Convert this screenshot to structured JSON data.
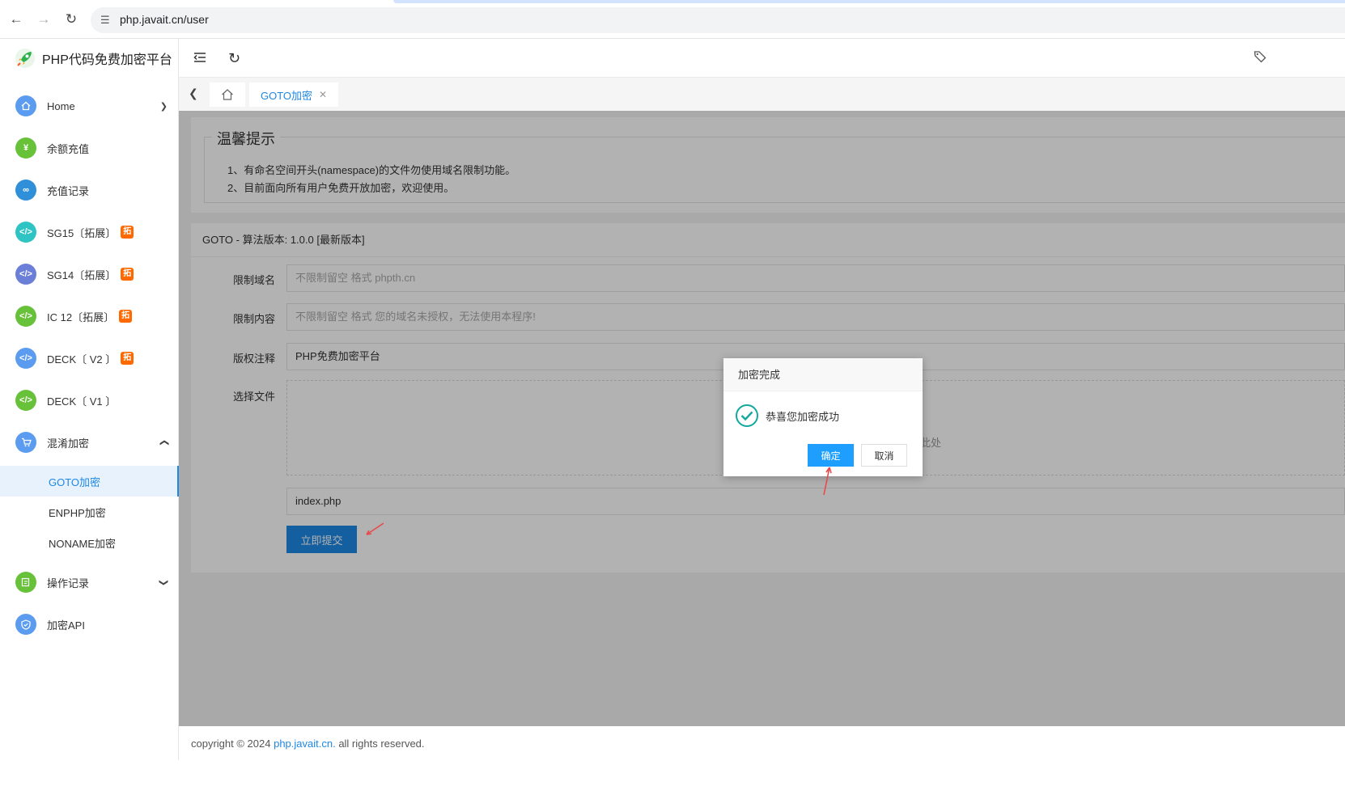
{
  "browser": {
    "url": "php.javait.cn/user"
  },
  "sidebar": {
    "logo_text": "PHP代码免费加密平台",
    "items": [
      {
        "label": "Home",
        "badge": "",
        "icon": "home-icon",
        "color": "#5b9cf0"
      },
      {
        "label": "余额充值",
        "badge": "",
        "icon": "recharge-icon",
        "color": "#67c23a"
      },
      {
        "label": "充值记录",
        "badge": "",
        "icon": "infinity-icon",
        "color": "#2f8fd8"
      },
      {
        "label": "SG15〔拓展〕",
        "badge": "拓",
        "icon": "code-icon",
        "color": "#2ec4c4"
      },
      {
        "label": "SG14〔拓展〕",
        "badge": "拓",
        "icon": "code-icon",
        "color": "#6c7fd8"
      },
      {
        "label": "IC 12〔拓展〕",
        "badge": "拓",
        "icon": "code-icon",
        "color": "#67c23a"
      },
      {
        "label": "DECK〔 V2 〕",
        "badge": "拓",
        "icon": "code-icon",
        "color": "#5b9cf0"
      },
      {
        "label": "DECK〔 V1 〕",
        "badge": "",
        "icon": "code-icon",
        "color": "#67c23a"
      },
      {
        "label": "混淆加密",
        "badge": "",
        "icon": "cart-icon",
        "color": "#5b9cf0"
      },
      {
        "label": "操作记录",
        "badge": "",
        "icon": "edit-icon",
        "color": "#67c23a"
      },
      {
        "label": "加密API",
        "badge": "",
        "icon": "shield-icon",
        "color": "#5b9cf0"
      }
    ],
    "submenu": [
      "GOTO加密",
      "ENPHP加密",
      "NONAME加密"
    ]
  },
  "tabs": {
    "active_tab": "GOTO加密"
  },
  "notice": {
    "title": "温馨提示",
    "lines": [
      "1、有命名空间开头(namespace)的文件勿使用域名限制功能。",
      "2、目前面向所有用户免费开放加密，欢迎使用。"
    ]
  },
  "form": {
    "header": "GOTO - 算法版本: 1.0.0 [最新版本]",
    "domain_label": "限制域名",
    "domain_placeholder": "不限制留空 格式 phpth.cn",
    "content_label": "限制内容",
    "content_placeholder": "不限制留空 格式 您的域名未授权，无法使用本程序!",
    "copyright_label": "版权注释",
    "copyright_value": "PHP免费加密平台",
    "file_label": "选择文件",
    "upload_hint": "此处",
    "filename": "index.php",
    "submit_label": "立即提交"
  },
  "dialog": {
    "title": "加密完成",
    "message": "恭喜您加密成功",
    "ok_label": "确定",
    "cancel_label": "取消"
  },
  "footer": {
    "prefix": "copyright © 2024 ",
    "link": "php.javait.cn.",
    "suffix": " all rights reserved."
  },
  "colors": {
    "accent": "#1e88e5",
    "dialog_button": "#1e9fff",
    "success": "#13a89e",
    "annotation_arrow": "#e84a4a"
  }
}
